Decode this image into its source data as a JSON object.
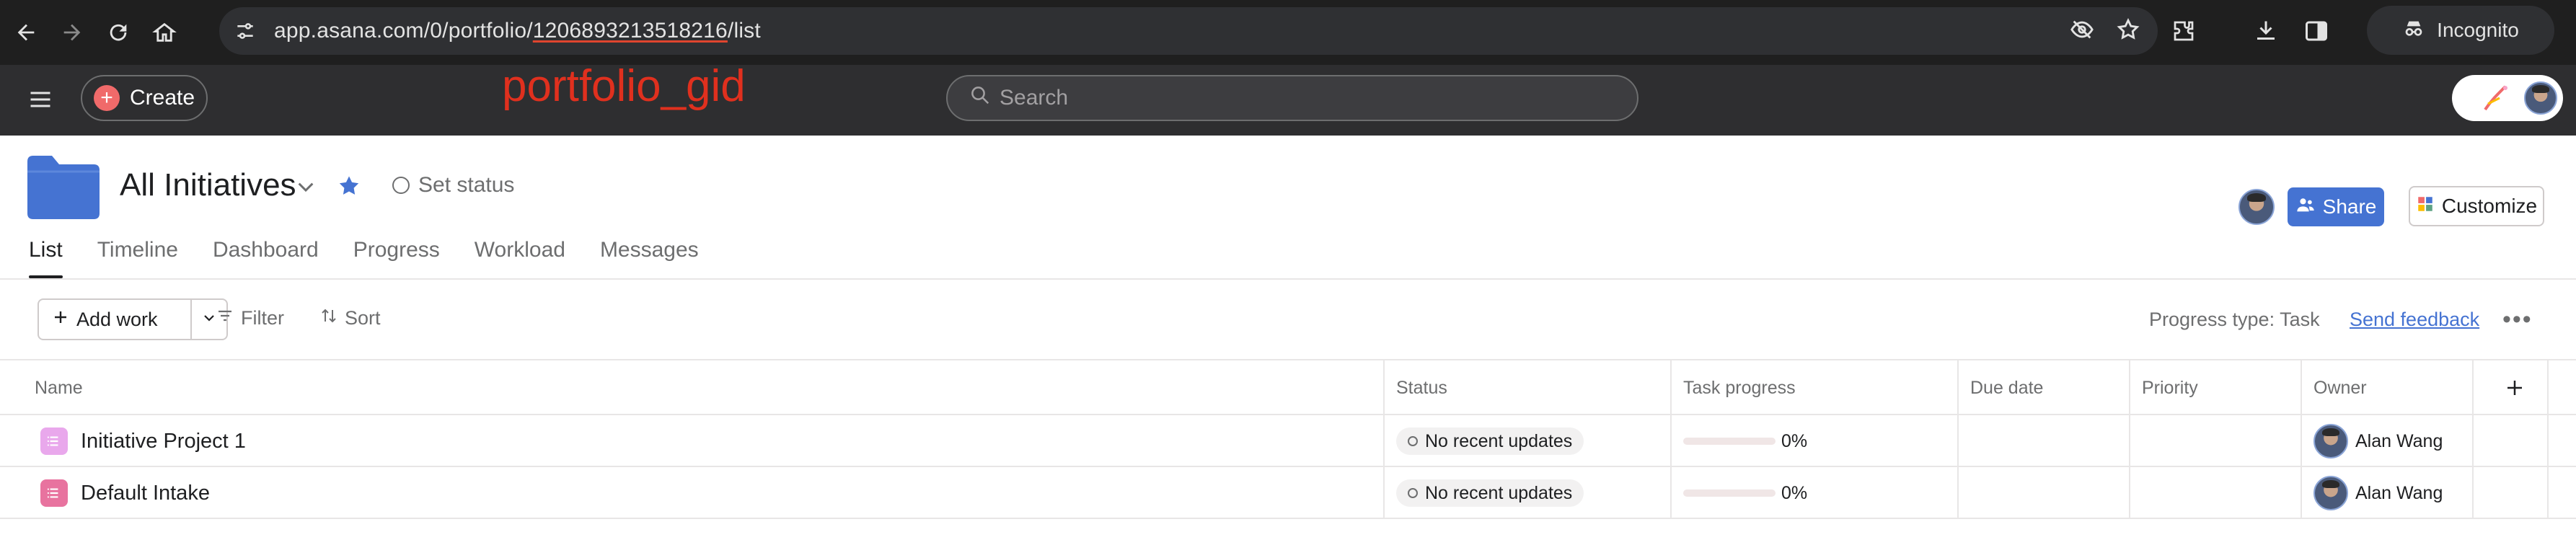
{
  "browser": {
    "url_prefix": "app.asana.com/0/portfolio/",
    "url_gid": "1206893213518216",
    "url_suffix": "/list",
    "incognito_label": "Incognito"
  },
  "annotation": {
    "text": "portfolio_gid",
    "color": "#e0301e"
  },
  "topbar": {
    "create_label": "Create",
    "search_placeholder": "Search"
  },
  "header": {
    "title": "All Initiatives",
    "set_status_label": "Set status",
    "share_label": "Share",
    "customize_label": "Customize"
  },
  "tabs": [
    {
      "label": "List",
      "active": true
    },
    {
      "label": "Timeline"
    },
    {
      "label": "Dashboard"
    },
    {
      "label": "Progress"
    },
    {
      "label": "Workload"
    },
    {
      "label": "Messages"
    }
  ],
  "toolbar": {
    "add_work_label": "Add work",
    "filter_label": "Filter",
    "sort_label": "Sort",
    "progress_type_label": "Progress type: Task",
    "send_feedback_label": "Send feedback"
  },
  "table": {
    "columns": [
      "Name",
      "Status",
      "Task progress",
      "Due date",
      "Priority",
      "Owner"
    ],
    "rows": [
      {
        "name": "Initiative Project 1",
        "icon_color": "#e9a8ec",
        "status": "No recent updates",
        "progress_value": 0,
        "progress_label": "0%",
        "due_date": "",
        "priority": "",
        "owner": "Alan Wang"
      },
      {
        "name": "Default Intake",
        "icon_color": "#e8739f",
        "status": "No recent updates",
        "progress_value": 0,
        "progress_label": "0%",
        "due_date": "",
        "priority": "",
        "owner": "Alan Wang"
      }
    ]
  },
  "colors": {
    "browser_bg": "#1f1f1f",
    "asana_topbar": "#2e2e30",
    "accent_blue": "#4573d2",
    "create_coral": "#f06a6a",
    "folder_blue": "#4573d2"
  }
}
